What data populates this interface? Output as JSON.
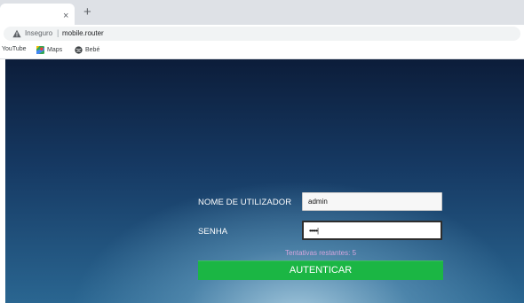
{
  "browser": {
    "tab_close": "×",
    "new_tab": "+",
    "address": {
      "security_label": "Inseguro",
      "separator": "|",
      "url": "mobile.router"
    },
    "bookmarks": [
      {
        "label": "YouTube",
        "icon": "youtube-icon"
      },
      {
        "label": "Maps",
        "icon": "maps-icon"
      },
      {
        "label": "Bebé",
        "icon": "globe-icon"
      }
    ]
  },
  "login": {
    "username_label": "NOME DE UTILIZADOR",
    "username_value": "admin",
    "password_label": "SENHA",
    "password_value": "•••••|",
    "attempts_text": "Tentativas restantes: 5",
    "submit_label": "AUTENTICAR"
  },
  "colors": {
    "button": "#1bb644",
    "attempts_text": "#d3a6dc",
    "background_top": "#0c1d3a",
    "background_glow": "#aacde1"
  }
}
